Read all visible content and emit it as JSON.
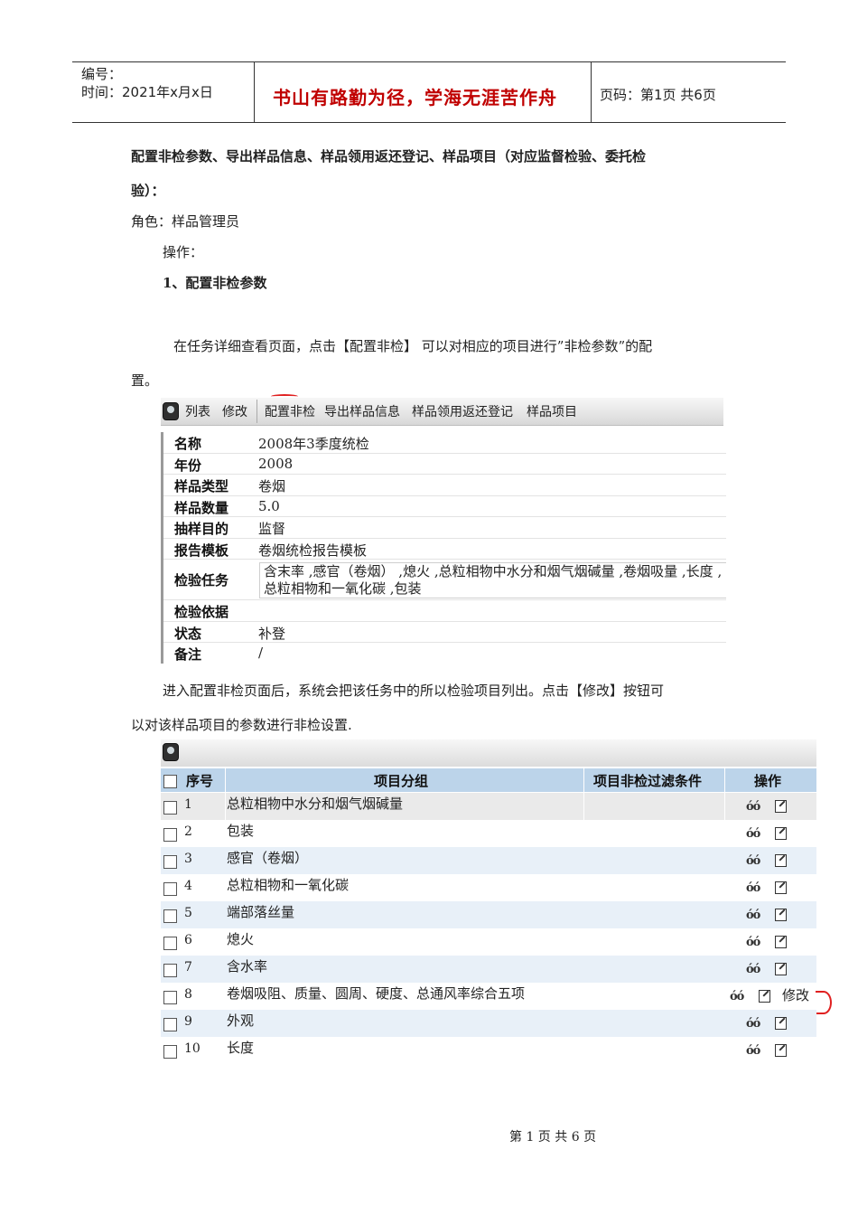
{
  "header": {
    "number_label": "编号：",
    "time_label": "时间：2021年x月x日",
    "motto": "书山有路勤为径，学海无涯苦作舟",
    "page_info": "页码：第1页  共6页"
  },
  "section": {
    "title_line1": "配置非检参数、导出样品信息、样品领用返还登记、样品项目（对应监督检验、委托检",
    "title_line2": "验）：",
    "role": "角色：样品管理员",
    "operation": "操作：",
    "step1": "1、配置非检参数",
    "para1_line1": "在任务详细查看页面，点击【配置非检】 可以对相应的项目进行”非检参数”的配",
    "para1_line2": "置。",
    "para2_line1": "进入配置非检页面后，系统会把该任务中的所以检验项目列出。点击【修改】按钮可",
    "para2_line2": "以对该样品项目的参数进行非检设置."
  },
  "toolbar1": {
    "items": [
      "列表",
      "修改",
      "配置非检",
      "导出样品信息",
      "样品领用返还登记",
      "样品项目"
    ]
  },
  "detail": [
    {
      "label": "名称",
      "value": "2008年3季度统检"
    },
    {
      "label": "年份",
      "value": "2008"
    },
    {
      "label": "样品类型",
      "value": "卷烟"
    },
    {
      "label": "样品数量",
      "value": "5.0"
    },
    {
      "label": "抽样目的",
      "value": "监督"
    },
    {
      "label": "报告模板",
      "value": "卷烟统检报告模板"
    },
    {
      "label": "检验任务",
      "value": "含末率 ,感官（卷烟） ,熄火 ,总粒相物中水分和烟气烟碱量 ,卷烟吸量 ,长度 ,总粒相物和一氧化碳 ,包装"
    },
    {
      "label": "检验依据",
      "value": ""
    },
    {
      "label": "状态",
      "value": "补登"
    },
    {
      "label": "备注",
      "value": "/"
    }
  ],
  "grid": {
    "headers": [
      "序号",
      "项目分组",
      "项目非检过滤条件",
      "操作"
    ],
    "rows": [
      {
        "num": "1",
        "name": "总粒相物中水分和烟气烟碱量"
      },
      {
        "num": "2",
        "name": "包装"
      },
      {
        "num": "3",
        "name": "感官（卷烟）"
      },
      {
        "num": "4",
        "name": "总粒相物和一氧化碳"
      },
      {
        "num": "5",
        "name": "端部落丝量"
      },
      {
        "num": "6",
        "name": "熄火"
      },
      {
        "num": "7",
        "name": "含水率"
      },
      {
        "num": "8",
        "name": "卷烟吸阻、质量、圆周、硬度、总通风率综合五项"
      },
      {
        "num": "9",
        "name": "外观"
      },
      {
        "num": "10",
        "name": "长度"
      }
    ],
    "modify_label": "修改",
    "view_icon": "glasses-icon",
    "edit_icon": "edit-icon"
  },
  "footer": {
    "text": "第 1 页 共 6 页"
  }
}
